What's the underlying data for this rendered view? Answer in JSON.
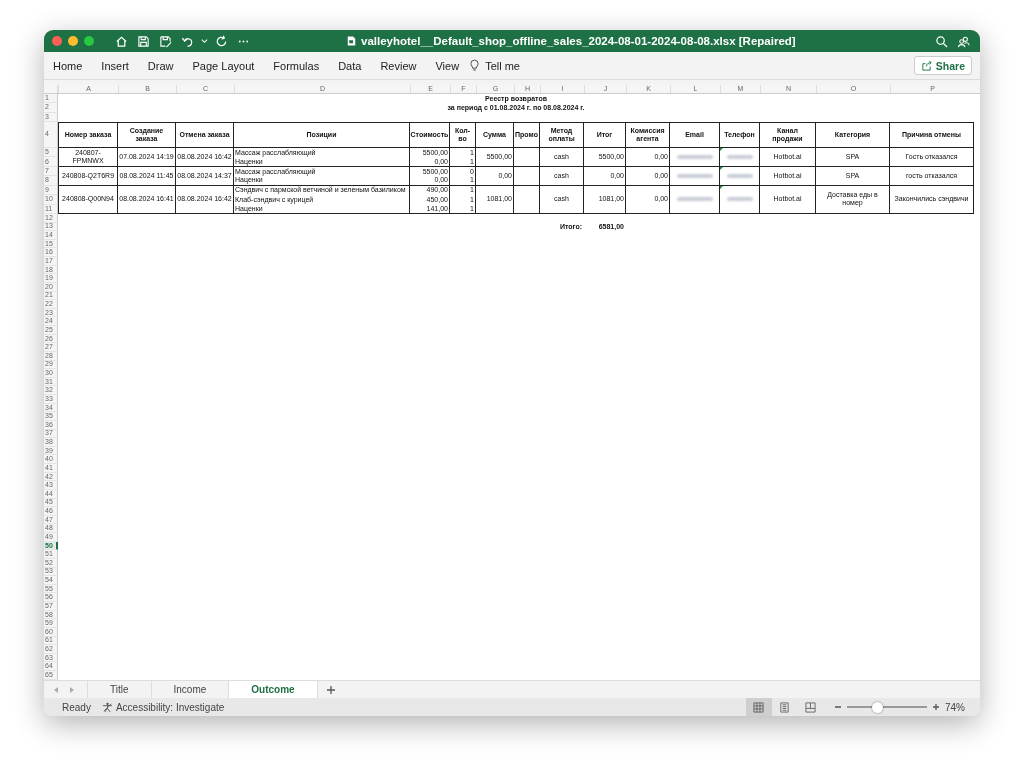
{
  "window": {
    "title": "valleyhotel__Default_shop_offline_sales_2024-08-01-2024-08-08.xlsx [Repaired]"
  },
  "ribbon": {
    "tabs": [
      "Home",
      "Insert",
      "Draw",
      "Page Layout",
      "Formulas",
      "Data",
      "Review",
      "View"
    ],
    "tell_me": "Tell me",
    "share": "Share"
  },
  "sheet": {
    "columns": [
      "A",
      "B",
      "C",
      "D",
      "E",
      "F",
      "G",
      "H",
      "I",
      "J",
      "K",
      "L",
      "M",
      "N",
      "O",
      "P"
    ],
    "row_numbers": [
      {
        "label": "1",
        "selected": false
      },
      {
        "label": "2",
        "selected": false
      },
      {
        "label": "3",
        "selected": false
      },
      {
        "label": "4",
        "selected": false
      },
      {
        "label": "5",
        "selected": false
      },
      {
        "label": "6",
        "selected": false
      },
      {
        "label": "7",
        "selected": false
      },
      {
        "label": "8",
        "selected": false
      },
      {
        "label": "9",
        "selected": false
      },
      {
        "label": "10",
        "selected": false
      },
      {
        "label": "11",
        "selected": false
      },
      {
        "label": "12",
        "selected": false
      },
      {
        "label": "13",
        "selected": false
      },
      {
        "label": "14",
        "selected": false
      },
      {
        "label": "15",
        "selected": false
      },
      {
        "label": "16",
        "selected": false
      },
      {
        "label": "17",
        "selected": false
      },
      {
        "label": "18",
        "selected": false
      },
      {
        "label": "19",
        "selected": false
      },
      {
        "label": "20",
        "selected": false
      },
      {
        "label": "21",
        "selected": false
      },
      {
        "label": "22",
        "selected": false
      },
      {
        "label": "23",
        "selected": false
      },
      {
        "label": "24",
        "selected": false
      },
      {
        "label": "25",
        "selected": false
      },
      {
        "label": "26",
        "selected": false
      },
      {
        "label": "27",
        "selected": false
      },
      {
        "label": "28",
        "selected": false
      },
      {
        "label": "29",
        "selected": false
      },
      {
        "label": "30",
        "selected": false
      },
      {
        "label": "31",
        "selected": false
      },
      {
        "label": "32",
        "selected": false
      },
      {
        "label": "33",
        "selected": false
      },
      {
        "label": "34",
        "selected": false
      },
      {
        "label": "35",
        "selected": false
      },
      {
        "label": "36",
        "selected": false
      },
      {
        "label": "37",
        "selected": false
      },
      {
        "label": "38",
        "selected": false
      },
      {
        "label": "39",
        "selected": false
      },
      {
        "label": "40",
        "selected": false
      },
      {
        "label": "41",
        "selected": false
      },
      {
        "label": "42",
        "selected": false
      },
      {
        "label": "43",
        "selected": false
      },
      {
        "label": "44",
        "selected": false
      },
      {
        "label": "45",
        "selected": false
      },
      {
        "label": "46",
        "selected": false
      },
      {
        "label": "47",
        "selected": false
      },
      {
        "label": "48",
        "selected": false
      },
      {
        "label": "49",
        "selected": false
      },
      {
        "label": "50",
        "selected": true
      },
      {
        "label": "51",
        "selected": false
      },
      {
        "label": "52",
        "selected": false
      },
      {
        "label": "53",
        "selected": false
      },
      {
        "label": "54",
        "selected": false
      },
      {
        "label": "55",
        "selected": false
      },
      {
        "label": "56",
        "selected": false
      },
      {
        "label": "57",
        "selected": false
      },
      {
        "label": "58",
        "selected": false
      },
      {
        "label": "59",
        "selected": false
      },
      {
        "label": "60",
        "selected": false
      },
      {
        "label": "61",
        "selected": false
      },
      {
        "label": "62",
        "selected": false
      },
      {
        "label": "63",
        "selected": false
      },
      {
        "label": "64",
        "selected": false
      },
      {
        "label": "65",
        "selected": false
      }
    ],
    "title": "Реестр возвратов",
    "subtitle": "за период с 01.08.2024 г. по 08.08.2024 г.",
    "headers": [
      "Номер заказа",
      "Создание заказа",
      "Отмена заказа",
      "Позиции",
      "Стоимость",
      "Кол-во",
      "Сумма",
      "Промо",
      "Метод оплаты",
      "Итог",
      "Комиссия агента",
      "Email",
      "Телефон",
      "Канал продажи",
      "Категория",
      "Причина отмены"
    ],
    "orders": [
      {
        "order_no": "240807-FPMNWX",
        "created": "07.08.2024 14:19",
        "cancelled": "08.08.2024 16:42",
        "items": [
          {
            "name": "Массаж расслабляющий",
            "cost": "5500,00",
            "qty": "1"
          },
          {
            "name": "Наценки",
            "cost": "0,00",
            "qty": "1"
          }
        ],
        "sum": "5500,00",
        "payment": "cash",
        "total": "5500,00",
        "commission": "0,00",
        "phone_flagged": true,
        "channel": "Hotbot.ai",
        "category": "SPA",
        "reason": "Гость отказался"
      },
      {
        "order_no": "240808-Q2T6R9",
        "created": "08.08.2024 11:45",
        "cancelled": "08.08.2024 14:37",
        "items": [
          {
            "name": "Массаж расслабляющий",
            "cost": "5500,00",
            "qty": "0"
          },
          {
            "name": "Наценки",
            "cost": "0,00",
            "qty": "1"
          }
        ],
        "sum": "0,00",
        "payment": "cash",
        "total": "0,00",
        "commission": "0,00",
        "phone_flagged": true,
        "channel": "Hotbot.ai",
        "category": "SPA",
        "reason": "гость отказался"
      },
      {
        "order_no": "240808-Q00N94",
        "created": "08.08.2024 16:41",
        "cancelled": "08.08.2024 16:42",
        "items": [
          {
            "name": "Сэндвич с пармской ветчиной и зеленым базиликом",
            "cost": "490,00",
            "qty": "1"
          },
          {
            "name": "Клаб-сэндвич с курицей",
            "cost": "450,00",
            "qty": "1"
          },
          {
            "name": "Наценки",
            "cost": "141,00",
            "qty": "1"
          }
        ],
        "sum": "1081,00",
        "payment": "cash",
        "total": "1081,00",
        "commission": "0,00",
        "phone_flagged": true,
        "channel": "Hotbot.ai",
        "category": "Доставка еды в номер",
        "reason": "Закончились сэндвичи"
      }
    ],
    "grand_total_label": "Итого:",
    "grand_total": "6581,00"
  },
  "sheet_tabs": [
    {
      "label": "Title",
      "selected": false
    },
    {
      "label": "Income",
      "selected": false
    },
    {
      "label": "Outcome",
      "selected": true
    }
  ],
  "status_bar": {
    "status": "Ready",
    "accessibility": "Accessibility: Investigate",
    "views": [
      {
        "kind": "normal",
        "selected": true
      },
      {
        "kind": "page_layout",
        "selected": false
      },
      {
        "kind": "page_break",
        "selected": false
      }
    ],
    "zoom": {
      "level": 0.375,
      "reading": "74%"
    }
  }
}
